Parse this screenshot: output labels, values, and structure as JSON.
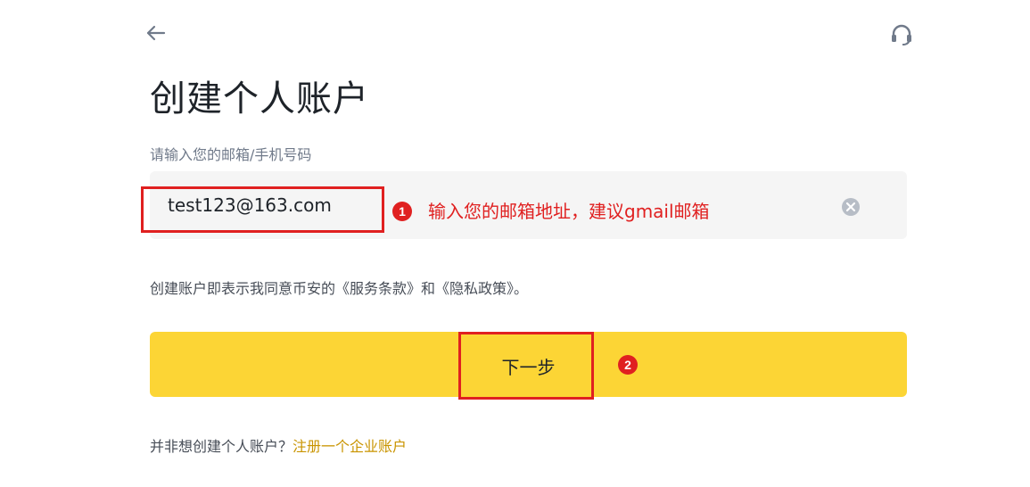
{
  "header": {
    "back_icon": "arrow-left-icon",
    "support_icon": "headset-icon"
  },
  "title": "创建个人账户",
  "email_field": {
    "label": "请输入您的邮箱/手机号码",
    "value": "test123@163.com",
    "clear_icon": "clear-circle-icon"
  },
  "annotations": {
    "step1_number": "1",
    "step1_text": "输入您的邮箱地址，建议gmail邮箱",
    "step2_number": "2",
    "color": "#e02020"
  },
  "terms_text": "创建账户即表示我同意币安的《服务条款》和《隐私政策》。",
  "next_button": {
    "label": "下一步",
    "color": "#fcd535"
  },
  "bottom": {
    "prompt": "并非想创建个人账户？",
    "link": "注册一个企业账户",
    "link_color": "#c99400"
  }
}
